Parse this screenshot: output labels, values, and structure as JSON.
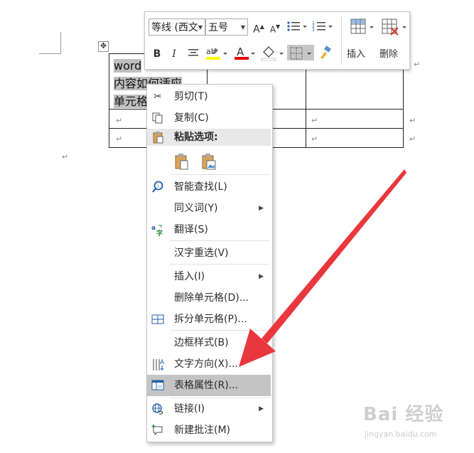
{
  "table": {
    "cell_text_lines": [
      "word",
      "内容如何适应",
      "单元格"
    ],
    "para_mark": "↵"
  },
  "mini_toolbar": {
    "font_name": "等线 (西文",
    "font_size": "五号",
    "grow_font_icon": "A",
    "shrink_font_icon": "A",
    "bold": "B",
    "italic": "I",
    "center_align": "center-align-icon",
    "highlight_color": "#ffff00",
    "font_color": "#e00000",
    "insert_label": "插入",
    "delete_label": "删除"
  },
  "context_menu": {
    "items": [
      {
        "label": "剪切(T)",
        "icon": "scissors-icon"
      },
      {
        "label": "复制(C)",
        "icon": "copy-icon"
      },
      {
        "label": "粘贴选项:",
        "icon": "paste-icon"
      },
      {
        "label": "智能查找(L)",
        "icon": "smart-lookup-icon"
      },
      {
        "label": "同义词(Y)",
        "icon": "",
        "submenu": true
      },
      {
        "label": "翻译(S)",
        "icon": "translate-icon"
      },
      {
        "label": "汉字重选(V)",
        "icon": ""
      },
      {
        "label": "插入(I)",
        "icon": "",
        "submenu": true
      },
      {
        "label": "删除单元格(D)...",
        "icon": ""
      },
      {
        "label": "拆分单元格(P)...",
        "icon": "split-cells-icon"
      },
      {
        "label": "边框样式(B)",
        "icon": "",
        "submenu": true
      },
      {
        "label": "文字方向(X)...",
        "icon": "text-direction-icon"
      },
      {
        "label": "表格属性(R)...",
        "icon": "table-properties-icon",
        "highlighted": true
      },
      {
        "label": "链接(I)",
        "icon": "link-icon",
        "submenu": true
      },
      {
        "label": "新建批注(M)",
        "icon": "new-comment-icon"
      }
    ],
    "submenu_arrow": "▶"
  },
  "annotation": {
    "arrow_color": "#e8383d"
  },
  "watermark": {
    "logo_text": "Bai 经验",
    "url": "jingyan.baidu.com"
  }
}
